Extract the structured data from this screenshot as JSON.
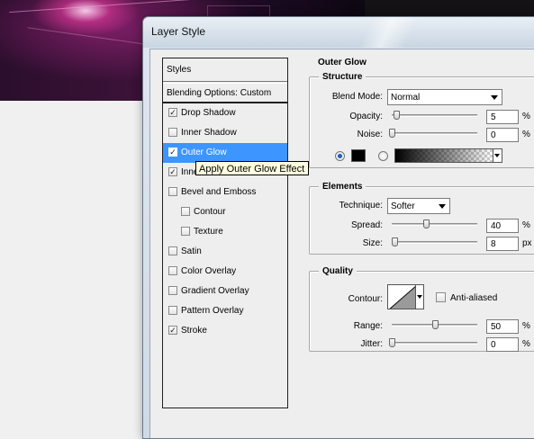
{
  "window": {
    "title": "Layer Style"
  },
  "styles_panel": {
    "header": "Styles",
    "blending_options": "Blending Options: Custom",
    "items": [
      {
        "label": "Drop Shadow",
        "checked": true
      },
      {
        "label": "Inner Shadow",
        "checked": false
      },
      {
        "label": "Outer Glow",
        "checked": true,
        "selected": true
      },
      {
        "label": "Inne",
        "checked": true
      },
      {
        "label": "Bevel and Emboss",
        "checked": false
      },
      {
        "label": "Contour",
        "checked": false,
        "sub": true
      },
      {
        "label": "Texture",
        "checked": false,
        "sub": true
      },
      {
        "label": "Satin",
        "checked": false
      },
      {
        "label": "Color Overlay",
        "checked": false
      },
      {
        "label": "Gradient Overlay",
        "checked": false
      },
      {
        "label": "Pattern Overlay",
        "checked": false
      },
      {
        "label": "Stroke",
        "checked": true
      }
    ],
    "check_glyph": "✓"
  },
  "tooltip": "Apply Outer Glow Effect",
  "outer_glow": {
    "title": "Outer Glow",
    "structure": {
      "legend": "Structure",
      "blend_mode_label": "Blend Mode:",
      "blend_mode_value": "Normal",
      "opacity_label": "Opacity:",
      "opacity_value": "5",
      "opacity_level": 0.05,
      "noise_label": "Noise:",
      "noise_value": "0",
      "noise_level": 0,
      "percent": "%",
      "color_mode_selected": "solid",
      "glow_color": "#000000"
    },
    "elements": {
      "legend": "Elements",
      "technique_label": "Technique:",
      "technique_value": "Softer",
      "spread_label": "Spread:",
      "spread_value": "40",
      "spread_level": 0.4,
      "size_label": "Size:",
      "size_value": "8",
      "size_level": 0.03,
      "percent": "%",
      "px": "px"
    },
    "quality": {
      "legend": "Quality",
      "contour_label": "Contour:",
      "anti_aliased_label": "Anti-aliased",
      "anti_aliased_checked": false,
      "range_label": "Range:",
      "range_value": "50",
      "range_level": 0.5,
      "jitter_label": "Jitter:",
      "jitter_value": "0",
      "jitter_level": 0,
      "percent": "%"
    }
  }
}
